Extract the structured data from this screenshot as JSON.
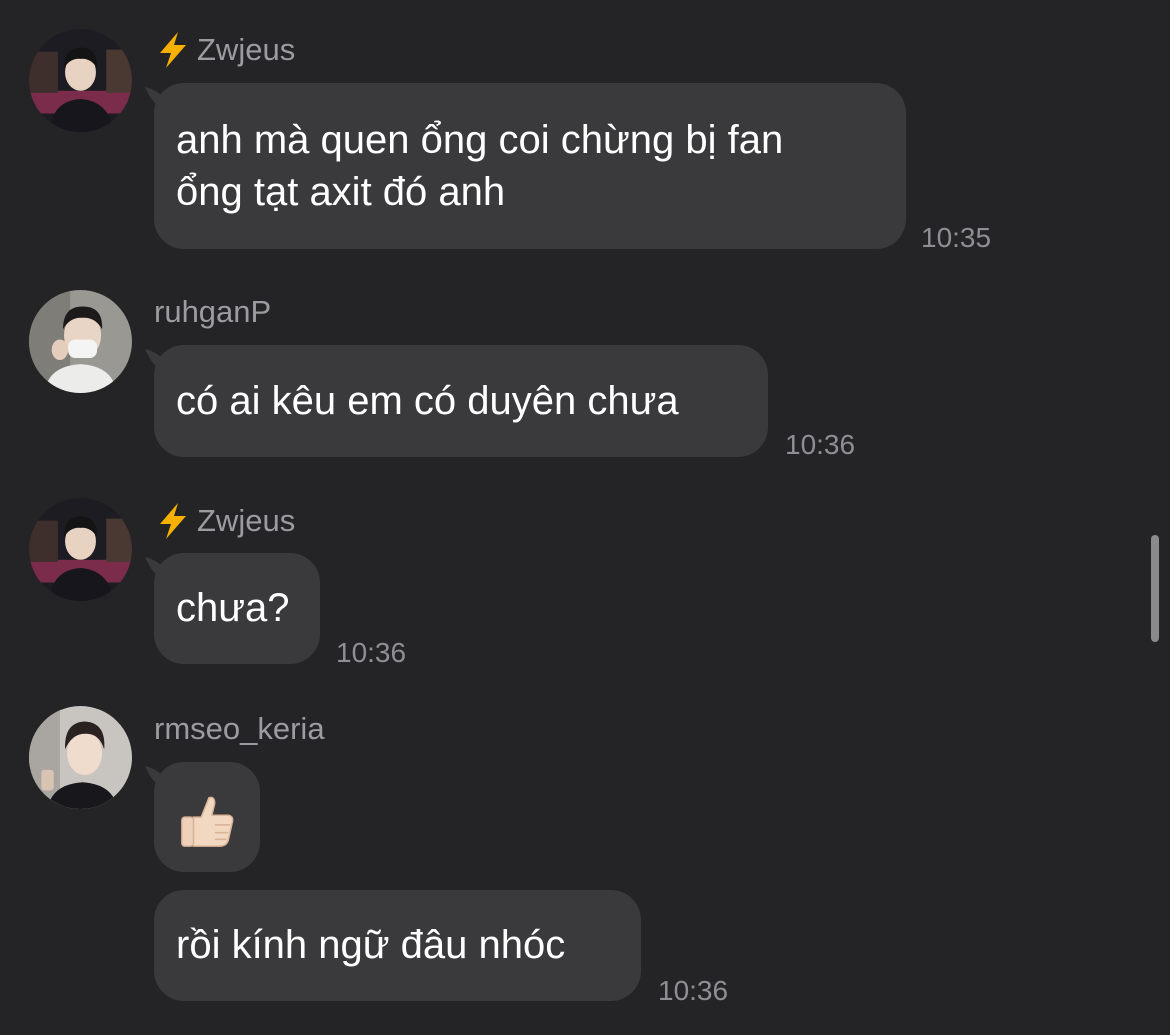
{
  "messages": [
    {
      "sender": "Zwjeus",
      "sender_icon": "lightning-bolt-icon",
      "avatar": "avatar-zwjeus",
      "text_lines": [
        "anh mà quen ổng coi chừng bị fan",
        "ổng tạt axit đó anh"
      ],
      "time": "10:35"
    },
    {
      "sender": "ruhganP",
      "avatar": "avatar-ruhganp",
      "text_lines": [
        "có ai kêu em có duyên chưa"
      ],
      "time": "10:36"
    },
    {
      "sender": "Zwjeus",
      "sender_icon": "lightning-bolt-icon",
      "avatar": "avatar-zwjeus",
      "text_lines": [
        "chưa?"
      ],
      "time": "10:36"
    },
    {
      "sender": "rmseo_keria",
      "avatar": "avatar-rmseo-keria",
      "emoji": "thumbs-up-icon",
      "text_lines": [
        "rồi kính ngữ đâu nhóc"
      ],
      "time": "10:36"
    }
  ],
  "colors": {
    "background": "#242426",
    "bubble": "#3a3a3c",
    "message_text": "#ffffff",
    "meta_text": "#8e8e93",
    "bolt": "#f6b100"
  }
}
